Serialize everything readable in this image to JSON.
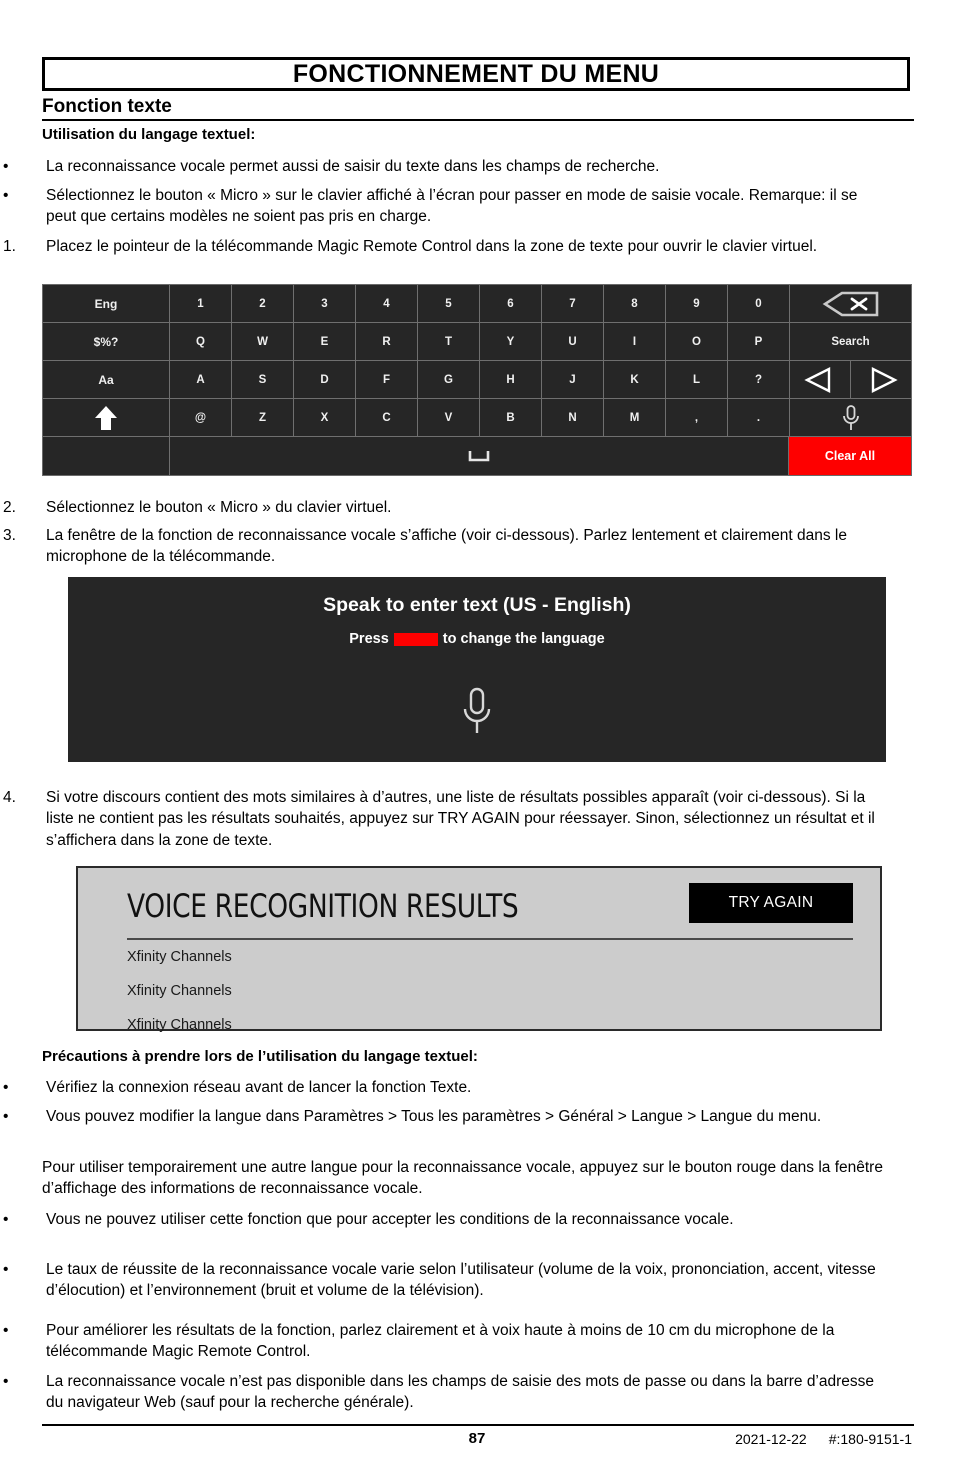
{
  "header": {
    "title": "FONCTIONNEMENT DU MENU",
    "section_title": "Fonction texte"
  },
  "intro": {
    "subhead": "Utilisation du langage textuel:",
    "items": [
      {
        "marker": "•",
        "text": "La reconnaissance vocale permet aussi de saisir du texte dans les champs de recherche."
      },
      {
        "marker": "•",
        "text": "Sélectionnez le bouton « Micro » sur le clavier affiché à l’écran pour passer en mode de saisie vocale. Remarque: il se peut que certains modèles ne soient pas pris en charge."
      },
      {
        "marker": "1.",
        "text": "Placez le pointeur de la télécommande Magic Remote Control dans la zone de texte pour ouvrir le clavier virtuel."
      }
    ]
  },
  "steps_mid": [
    {
      "marker": "2.",
      "text": "Sélectionnez le bouton « Micro » du clavier virtuel."
    },
    {
      "marker": "3.",
      "text": "La fenêtre de la fonction de reconnaissance vocale s’affiche (voir ci-dessous). Parlez lentement et clairement dans le microphone de la télécommande."
    }
  ],
  "step4": {
    "marker": "4.",
    "text": "Si votre discours contient des mots similaires à d’autres, une liste de résultats possibles apparaît (voir ci-dessous). Si la liste ne contient pas les résultats souhaités, appuyez sur TRY AGAIN pour réessayer. Sinon, sélectionnez un résultat et il s’affichera dans la zone de texte."
  },
  "keyboard": {
    "rows": [
      {
        "func": "Eng",
        "keys": [
          "1",
          "2",
          "3",
          "4",
          "5",
          "6",
          "7",
          "8",
          "9",
          "0"
        ],
        "right_label": "",
        "right_icon": "backspace-icon"
      },
      {
        "func": "$%?",
        "keys": [
          "Q",
          "W",
          "E",
          "R",
          "T",
          "Y",
          "U",
          "I",
          "O",
          "P"
        ],
        "right_label": "Search",
        "right_icon": ""
      },
      {
        "func": "Aa",
        "keys": [
          "A",
          "S",
          "D",
          "F",
          "G",
          "H",
          "J",
          "K",
          "L",
          "?"
        ],
        "right_label": "",
        "right_icon": "arrow-left-right-icons"
      },
      {
        "func": "",
        "func_icon": "shift-up-arrow-icon",
        "keys": [
          "@",
          "Z",
          "X",
          "C",
          "V",
          "B",
          "N",
          "M",
          ",",
          "."
        ],
        "right_label": "",
        "right_icon": "microphone-icon"
      }
    ],
    "bottom_row": {
      "spacebar_icon": "space-bar-icon",
      "clear_all_label": "Clear All",
      "clear_all_color": "#fe0000"
    },
    "background_color": "#262626",
    "key_text_color": "#f0f0f0"
  },
  "speak_window": {
    "title": "Speak to enter text (US - English)",
    "subtitle_before": "Press",
    "subtitle_after": "to change the language",
    "chip_color": "#fe0000",
    "mic_icon": "microphone-icon",
    "background_color": "#262626"
  },
  "voice_results": {
    "heading": "VOICE RECOGNITION RESULTS",
    "try_again_label": "TRY AGAIN",
    "items": [
      "Xfinity Channels",
      "Xfinity Channels",
      "Xfinity Channels"
    ],
    "background_color": "#cccccc"
  },
  "precautions": {
    "subhead": "Précautions à prendre lors de l’utilisation du langage textuel:",
    "items_top": [
      {
        "marker": "•",
        "text": "Vérifiez la connexion réseau avant de lancer la fonction Texte."
      },
      {
        "marker": "•",
        "text": "Vous pouvez modifier la langue dans Paramètres > Tous les paramètres > Général > Langue > Langue du menu."
      }
    ],
    "paragraph": "Pour utiliser temporairement une autre langue pour la reconnaissance vocale, appuyez sur le bouton rouge dans la fenêtre d’affichage des informations de reconnaissance vocale.",
    "items_bottom": [
      {
        "marker": "•",
        "text": "Vous ne pouvez utiliser cette fonction que pour accepter les conditions de la reconnaissance vocale."
      },
      {
        "marker": "•",
        "text": "Le taux de réussite de la reconnaissance vocale varie selon l’utilisateur (volume de la voix, prononciation, accent, vitesse d’élocution) et l’environnement (bruit et volume de la télévision)."
      },
      {
        "marker": "•",
        "text": "Pour améliorer les résultats de la fonction, parlez clairement et à voix haute à moins de 10 cm du microphone de la télécommande Magic Remote Control."
      },
      {
        "marker": "•",
        "text": "La reconnaissance vocale n’est pas disponible dans les champs de saisie des mots de passe ou dans la barre d’adresse du navigateur Web (sauf pour la recherche générale)."
      }
    ]
  },
  "footer": {
    "page_number": "87",
    "date": "2021-12-22",
    "doc_id": "#:180-9151-1"
  }
}
